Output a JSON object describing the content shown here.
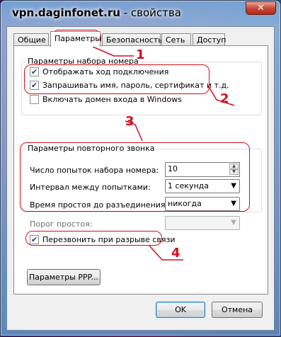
{
  "window": {
    "title_host": "vpn.daginfonet.ru",
    "title_suffix": " - свойства",
    "close_glyph": "✕"
  },
  "tabs": [
    "Общие",
    "Параметры",
    "Безопасность",
    "Сеть",
    "Доступ"
  ],
  "active_tab": 1,
  "dial_group": {
    "title": "Параметры набора номера",
    "show_progress": {
      "label": "Отображать ход подключения",
      "checked": true
    },
    "prompt_credentials": {
      "label": "Запрашивать имя, пароль, сертификат и т.д.",
      "checked": true
    },
    "include_domain": {
      "label": "Включать домен входа в Windows",
      "checked": false
    }
  },
  "redial_group": {
    "title": "Параметры повторного звонка",
    "attempts_label": "Число попыток набора номера:",
    "attempts_value": "10",
    "interval_label": "Интервал между попытками:",
    "interval_value": "1 секунда",
    "idle_label": "Время простоя до разъединения:",
    "idle_value": "никогда"
  },
  "idle_threshold": {
    "label": "Порог простоя:",
    "value": ""
  },
  "redial_on_drop": {
    "label": "Перезвонить при разрыве связи",
    "checked": true
  },
  "buttons": {
    "ppp": "Параметры PPP...",
    "ok": "OK",
    "cancel": "Отмена"
  },
  "annotations": [
    "1",
    "2",
    "3",
    "4"
  ],
  "annotation_color": "#d01020"
}
